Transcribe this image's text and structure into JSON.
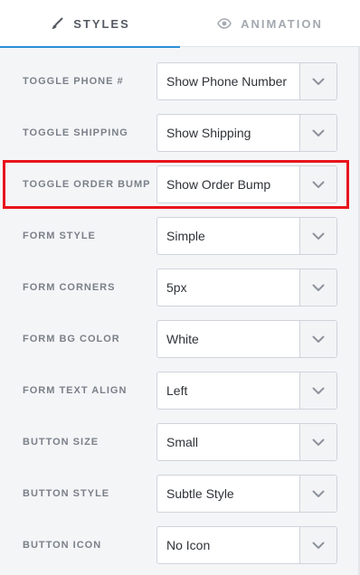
{
  "tabs": [
    {
      "label": "STYLES",
      "icon": "brush-icon",
      "active": true
    },
    {
      "label": "ANIMATION",
      "icon": "eye-icon",
      "active": false
    }
  ],
  "colors": {
    "accent": "#2b8fd6",
    "highlight": "#e8141c",
    "label": "#7a8089",
    "value": "#2f3338"
  },
  "rows": [
    {
      "label": "TOGGLE PHONE #",
      "value": "Show Phone Number"
    },
    {
      "label": "TOGGLE SHIPPING",
      "value": "Show Shipping"
    },
    {
      "label": "TOGGLE ORDER BUMP",
      "value": "Show Order Bump",
      "highlighted": true
    },
    {
      "label": "FORM STYLE",
      "value": "Simple"
    },
    {
      "label": "FORM CORNERS",
      "value": "5px"
    },
    {
      "label": "FORM BG COLOR",
      "value": "White"
    },
    {
      "label": "FORM TEXT ALIGN",
      "value": "Left"
    },
    {
      "label": "BUTTON SIZE",
      "value": "Small"
    },
    {
      "label": "BUTTON STYLE",
      "value": "Subtle Style"
    },
    {
      "label": "BUTTON ICON",
      "value": "No Icon"
    }
  ]
}
